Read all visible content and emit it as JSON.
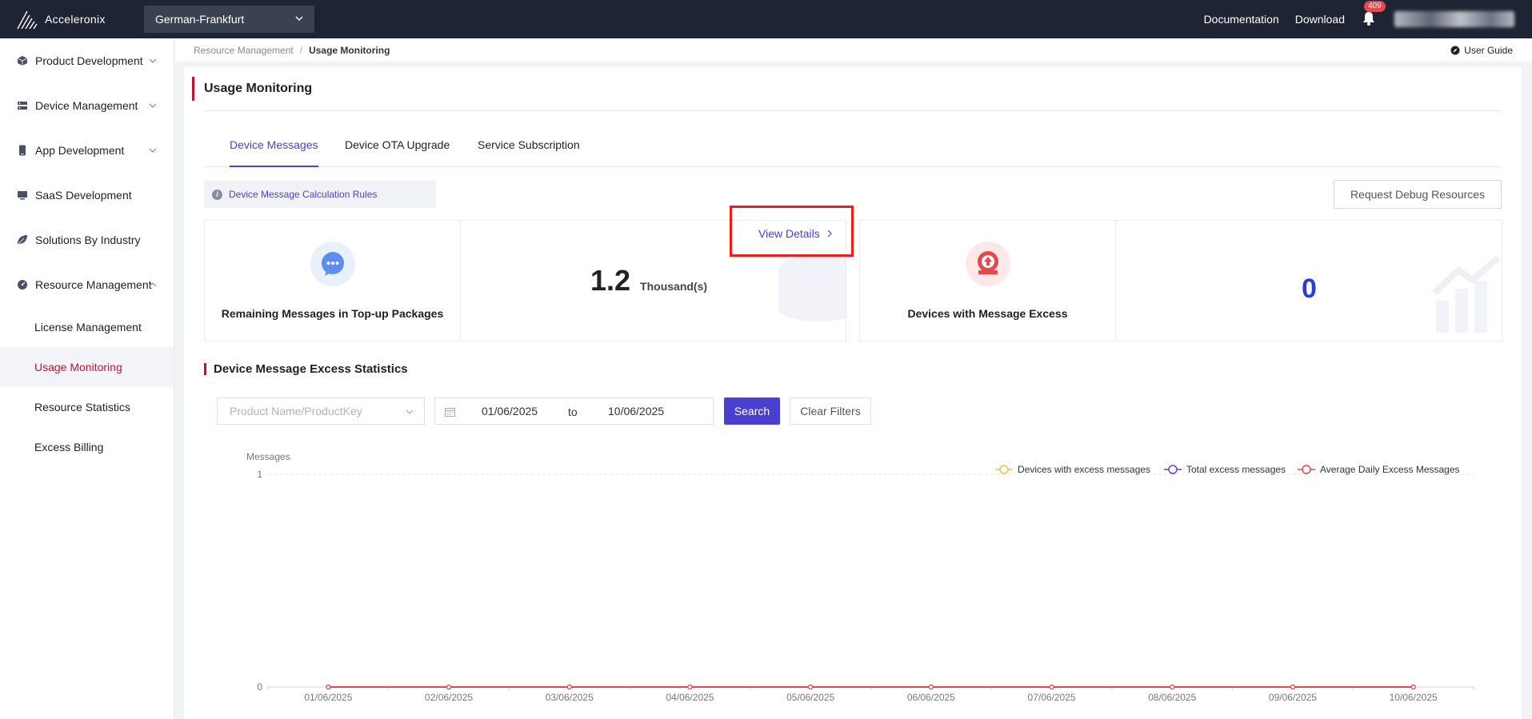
{
  "app": {
    "brand": "Acceleronix",
    "region": "German-Frankfurt",
    "nav_links": [
      "Documentation",
      "Download"
    ],
    "notification_count": "409"
  },
  "sidebar": {
    "items": [
      {
        "label": "Product Development",
        "icon": "cube-icon",
        "expandable": true
      },
      {
        "label": "Device Management",
        "icon": "server-icon",
        "expandable": true
      },
      {
        "label": "App Development",
        "icon": "mobile-icon",
        "expandable": true
      },
      {
        "label": "SaaS Development",
        "icon": "monitor-icon",
        "expandable": false
      },
      {
        "label": "Solutions By Industry",
        "icon": "leaf-icon",
        "expandable": false
      },
      {
        "label": "Resource Management",
        "icon": "gauge-icon",
        "expandable": true,
        "expanded": true
      }
    ],
    "sub_items": [
      {
        "label": "License Management",
        "active": false
      },
      {
        "label": "Usage Monitoring",
        "active": true
      },
      {
        "label": "Resource Statistics",
        "active": false
      },
      {
        "label": "Excess Billing",
        "active": false
      }
    ]
  },
  "breadcrumb": {
    "parent": "Resource Management",
    "separator": "/",
    "current": "Usage Monitoring"
  },
  "user_guide": "User Guide",
  "page": {
    "title": "Usage Monitoring",
    "tabs": [
      {
        "label": "Device Messages",
        "active": true
      },
      {
        "label": "Device OTA Upgrade",
        "active": false
      },
      {
        "label": "Service Subscription",
        "active": false
      }
    ],
    "rules_link": "Device Message Calculation Rules",
    "debug_button": "Request Debug Resources"
  },
  "stats": {
    "remaining": {
      "label": "Remaining Messages in Top-up Packages",
      "value": "1.2",
      "unit": "Thousand(s)",
      "link": "View Details"
    },
    "excess": {
      "label": "Devices with Message Excess",
      "value": "0"
    }
  },
  "section": {
    "title": "Device Message Excess Statistics",
    "filters": {
      "product_placeholder": "Product Name/ProductKey",
      "date_from": "01/06/2025",
      "date_to": "10/06/2025",
      "to_label": "to",
      "search": "Search",
      "clear": "Clear Filters"
    }
  },
  "chart_data": {
    "type": "line",
    "ylabel": "Messages",
    "ylim": [
      0,
      1
    ],
    "yticks": [
      "0",
      "1"
    ],
    "legend_position": "top-right",
    "categories": [
      "01/06/2025",
      "02/06/2025",
      "03/06/2025",
      "04/06/2025",
      "05/06/2025",
      "06/06/2025",
      "07/06/2025",
      "08/06/2025",
      "09/06/2025",
      "10/06/2025"
    ],
    "series": [
      {
        "name": "Devices with excess messages",
        "color": "#f2c14e",
        "values": [
          0,
          0,
          0,
          0,
          0,
          0,
          0,
          0,
          0,
          0
        ]
      },
      {
        "name": "Total excess messages",
        "color": "#6c3fd6",
        "values": [
          0,
          0,
          0,
          0,
          0,
          0,
          0,
          0,
          0,
          0
        ]
      },
      {
        "name": "Average Daily Excess Messages",
        "color": "#e5484d",
        "values": [
          0,
          0,
          0,
          0,
          0,
          0,
          0,
          0,
          0,
          0
        ]
      }
    ]
  }
}
